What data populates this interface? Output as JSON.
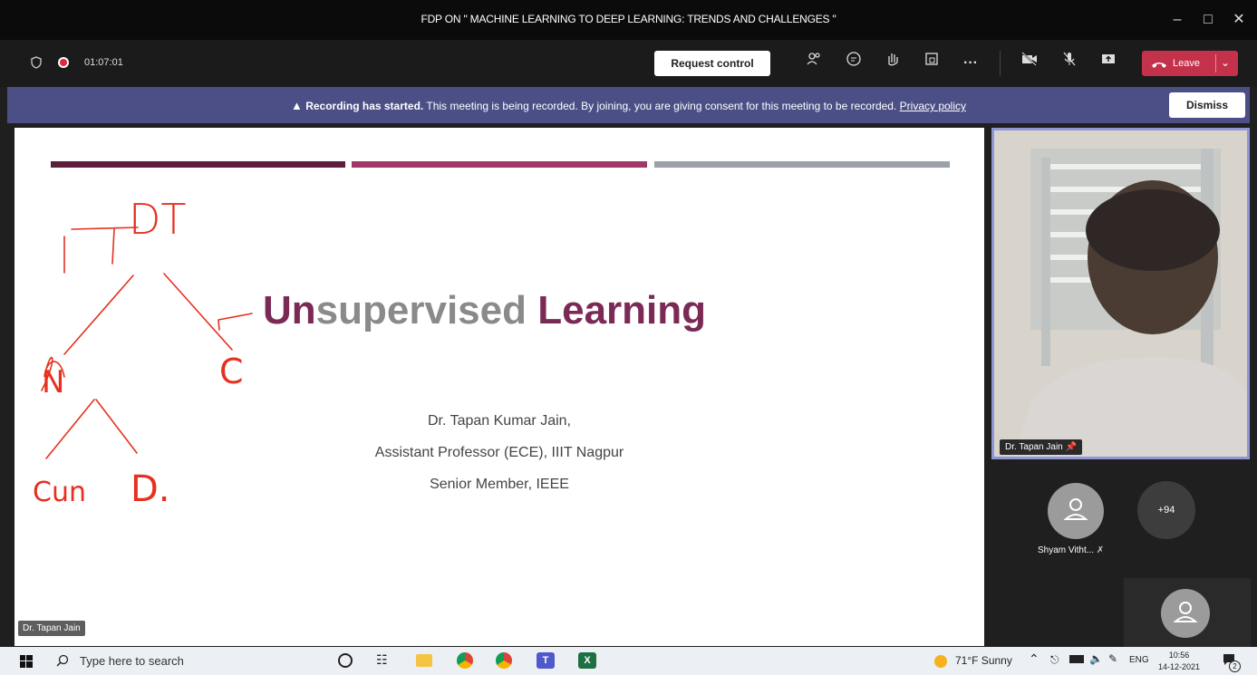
{
  "window": {
    "title": "FDP ON \" MACHINE LEARNING TO DEEP LEARNING: TRENDS AND CHALLENGES \""
  },
  "toolbar": {
    "timer": "01:07:01",
    "request_control_label": "Request control",
    "leave_label": "Leave"
  },
  "banner": {
    "bold": "Recording has started.",
    "text": "This meeting is being recorded. By joining, you are giving consent for this meeting to be recorded.",
    "link": "Privacy policy",
    "dismiss_label": "Dismiss"
  },
  "slide": {
    "title_un": "Un",
    "title_supervised": "supervised",
    "title_learning": "Learning",
    "author": "Dr. Tapan Kumar Jain,",
    "position": "Assistant Professor (ECE), IIIT Nagpur",
    "membership": "Senior Member, IEEE",
    "annotations": {
      "root": "DT",
      "left": "N",
      "right": "C",
      "left_left": "Cun",
      "left_right": "D."
    },
    "presenter_tag": "Dr. Tapan Jain"
  },
  "participants": {
    "pinned_name": "Dr. Tapan Jain",
    "other_name": "Shyam Vitht...",
    "more_count": "+94"
  },
  "taskbar": {
    "search_placeholder": "Type here to search",
    "weather": "71°F  Sunny",
    "language": "ENG",
    "time": "10:56",
    "date": "14-12-2021",
    "notif_count": "2"
  },
  "colors": {
    "accent_leave": "#c4314b",
    "banner": "#4b4f86",
    "title_plum": "#7a2a55",
    "title_grey": "#8a8a8a",
    "annotation_red": "#e5311f"
  }
}
